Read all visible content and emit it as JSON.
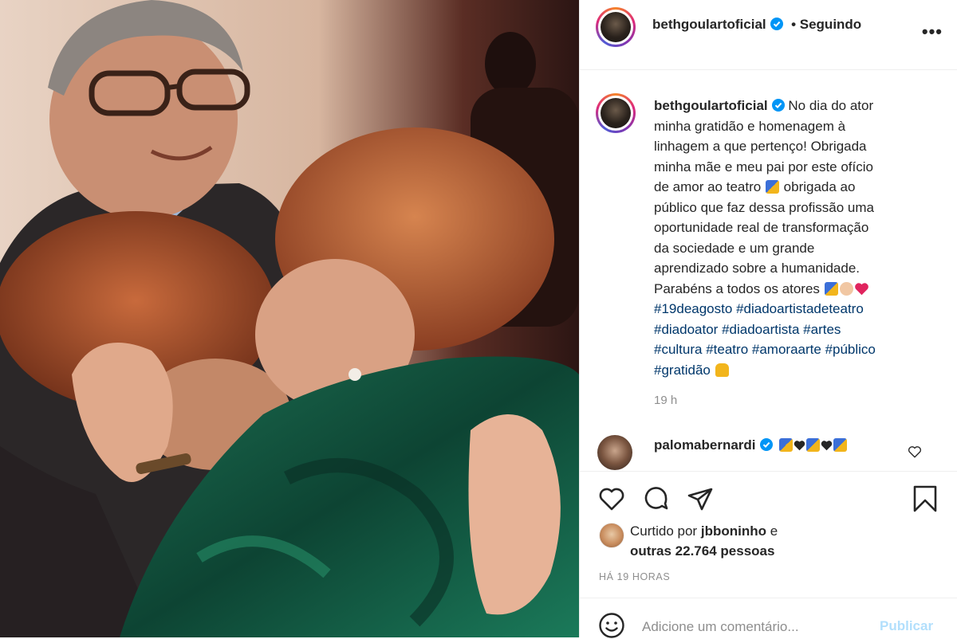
{
  "post": {
    "author": "beth goulartoficial",
    "follow_state": "• Seguindo",
    "more_label": "•••"
  },
  "caption": {
    "author": "bethgoulartoficial",
    "lines": [
      "No dia do ator",
      "minha gratidão e homenagem à",
      "linhagem a que pertenço! Obrigada",
      "minha mãe e meu pai por este ofício",
      "de amor ao teatro",
      "obrigada ao",
      "público que faz dessa profissão uma",
      "oportunidade real de transformação",
      "da sociedade e um grande",
      "aprendizado sobre a humanidade.",
      "Parabéns a todos os atores"
    ],
    "hashtags": [
      "#19deagosto",
      "#diadoartistadeteatro",
      "#diadoator",
      "#diadoartista",
      "#artes",
      "#cultura",
      "#teatro",
      "#amoraarte",
      "#público",
      "#gratidão"
    ],
    "time": "19 h"
  },
  "comment": {
    "author": "palomabernardi"
  },
  "likes": {
    "prefix": "Curtido por",
    "first_liker": "jbboninho",
    "connector": "e",
    "others": "outras 22.764 pessoas"
  },
  "timestamp": "HÁ 19 HORAS",
  "comment_box": {
    "placeholder": "Adicione um comentário...",
    "publish_label": "Publicar"
  },
  "colors": {
    "hashtag": "#00376b",
    "verified": "#0095f6",
    "publish_disabled": "#b2dffc",
    "heart_red": "#ed4956"
  },
  "icons": [
    "verified-badge-icon",
    "more-options-icon",
    "like-heart-icon",
    "comment-bubble-icon",
    "share-send-icon",
    "save-bookmark-icon",
    "emoji-smile-icon",
    "theater-masks-emoji",
    "clapping-hands-emoji",
    "red-heart-emoji",
    "black-heart-emoji",
    "praying-hands-emoji"
  ]
}
